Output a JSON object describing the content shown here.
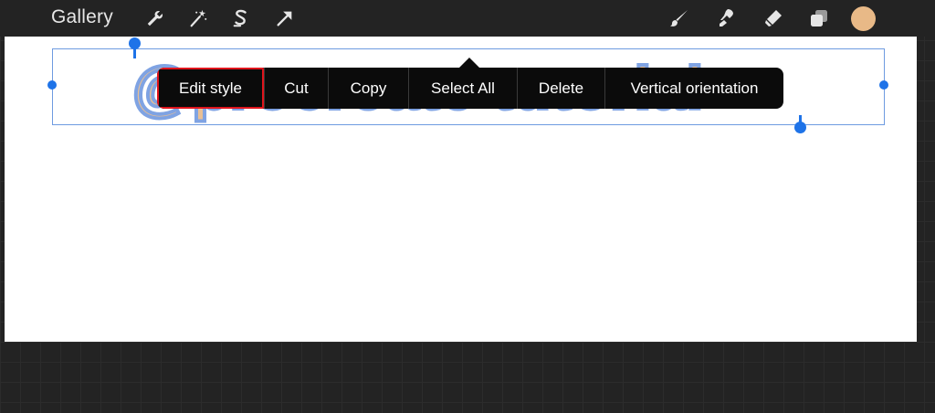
{
  "toolbar": {
    "gallery_label": "Gallery",
    "tools_left": [
      "wrench-icon",
      "magic-wand-icon",
      "selection-s-icon",
      "transform-arrow-icon"
    ],
    "tools_right": [
      "brush-icon",
      "smudge-icon",
      "eraser-icon",
      "layers-icon"
    ],
    "color_swatch": "#e8b987"
  },
  "canvas": {
    "text": "@procreate tutorial",
    "text_fill_color": "#e9c095",
    "text_outline_color": "#7fa3e3",
    "selection_color": "#1e73e8"
  },
  "context_menu": {
    "items": [
      {
        "label": "Edit style",
        "highlighted": true
      },
      {
        "label": "Cut"
      },
      {
        "label": "Copy"
      },
      {
        "label": "Select All"
      },
      {
        "label": "Delete"
      },
      {
        "label": "Vertical orientation"
      }
    ],
    "highlight_color": "#e0141c"
  }
}
